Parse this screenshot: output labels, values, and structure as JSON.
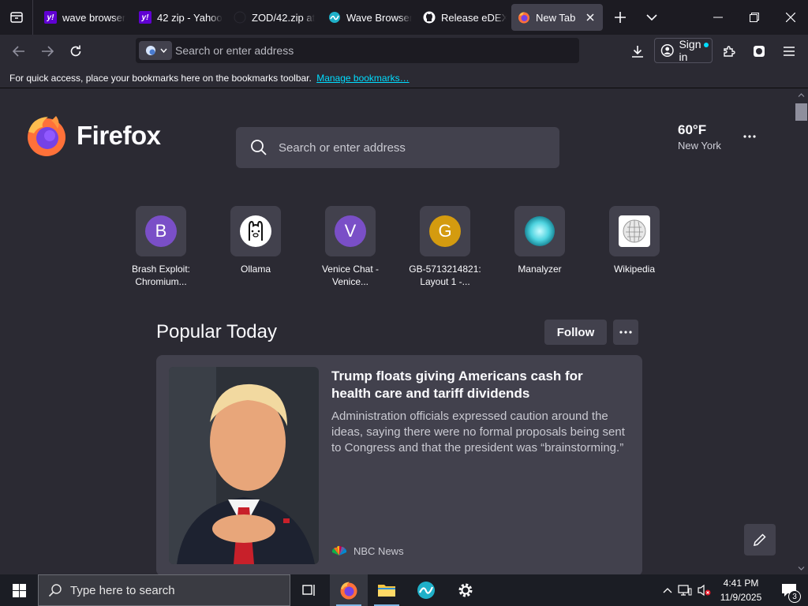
{
  "tabs": [
    {
      "title": "wave browser",
      "favicon": "yahoo-icon"
    },
    {
      "title": "42 zip - Yahoo",
      "favicon": "yahoo-icon"
    },
    {
      "title": "ZOD/42.zip at",
      "favicon": "github-icon"
    },
    {
      "title": "Wave Browser",
      "favicon": "wave-icon"
    },
    {
      "title": "Release eDEX-",
      "favicon": "github-icon"
    },
    {
      "title": "New Tab",
      "favicon": "firefox-icon",
      "active": true
    }
  ],
  "navbar": {
    "url_placeholder": "Search or enter address",
    "sign_in_label": "Sign in"
  },
  "bookmarks_bar": {
    "message": "For quick access, place your bookmarks here on the bookmarks toolbar.",
    "manage_link": "Manage bookmarks…"
  },
  "newtab": {
    "wordmark": "Firefox",
    "search_placeholder": "Search or enter address",
    "weather": {
      "temp": "60°F",
      "city": "New York"
    },
    "top_sites": [
      {
        "label": "Brash Exploit: Chromium...",
        "letter": "B",
        "color": "#7a4fc7"
      },
      {
        "label": "Ollama",
        "icon": "ollama-icon"
      },
      {
        "label": "Venice Chat - Venice...",
        "letter": "V",
        "color": "#7a4fc7"
      },
      {
        "label": "GB-5713214821: Layout 1 -...",
        "letter": "G",
        "color": "#d49b0f"
      },
      {
        "label": "Manalyzer",
        "icon": "manalyzer-icon"
      },
      {
        "label": "Wikipedia",
        "icon": "wikipedia-icon"
      }
    ],
    "popular_title": "Popular Today",
    "follow_label": "Follow",
    "story": {
      "headline": "Trump floats giving Americans cash for health care and tariff dividends",
      "excerpt": "Administration officials expressed caution around the ideas, saying there were no formal proposals being sent to Congress and that the president was “brainstorming.”",
      "source": "NBC News"
    }
  },
  "taskbar": {
    "search_placeholder": "Type here to search",
    "time": "4:41 PM",
    "date": "11/9/2025",
    "notification_count": "3"
  },
  "colors": {
    "accent_link": "#00ddff",
    "background": "#2b2a33",
    "surface": "#42414d"
  }
}
